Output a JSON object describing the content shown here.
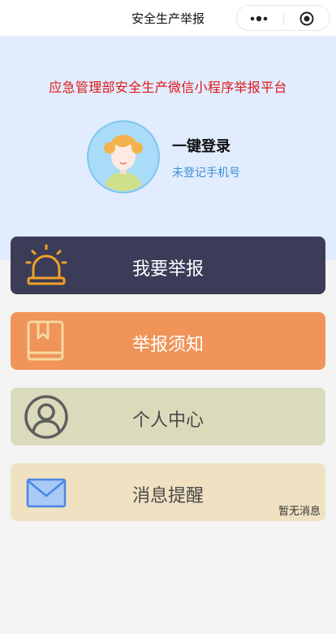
{
  "navbar": {
    "title": "安全生产举报",
    "more_icon": "more-dots-icon",
    "close_icon": "target-close-icon"
  },
  "header": {
    "platform_title": "应急管理部安全生产微信小程序举报平台",
    "login_label": "一键登录",
    "phone_status": "未登记手机号",
    "avatar_icon": "avatar-girl-icon"
  },
  "menu": [
    {
      "label": "我要举报",
      "icon": "alarm-siren-icon",
      "bg": "#3b3c58"
    },
    {
      "label": "举报须知",
      "icon": "book-bookmark-icon",
      "bg": "#f0945a"
    },
    {
      "label": "个人中心",
      "icon": "user-circle-icon",
      "bg": "#dadbbb"
    },
    {
      "label": "消息提醒",
      "icon": "mail-envelope-icon",
      "bg": "#efe1c1",
      "status": "暂无消息"
    }
  ],
  "colors": {
    "header_bg": "#e1ecfe",
    "platform_title": "#e01818",
    "phone_status": "#3e8ed6",
    "page_bg": "#f4f4f4"
  }
}
